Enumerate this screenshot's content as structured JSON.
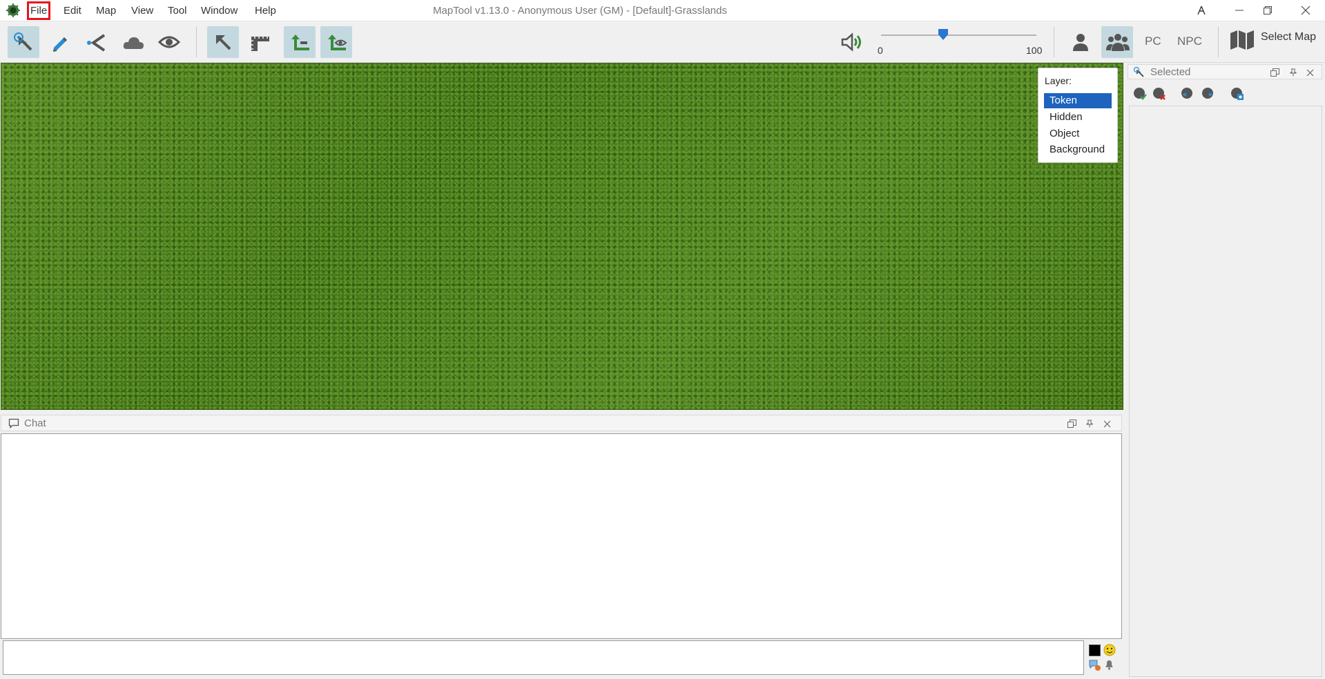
{
  "window": {
    "title": "MapTool v1.13.0 - Anonymous User (GM) - [Default]-Grasslands"
  },
  "menu": {
    "items": [
      {
        "label": "File",
        "highlighted": true
      },
      {
        "label": "Edit"
      },
      {
        "label": "Map"
      },
      {
        "label": "View"
      },
      {
        "label": "Tool"
      },
      {
        "label": "Window"
      },
      {
        "label": "Help"
      }
    ]
  },
  "toolbar": {
    "tools": [
      {
        "icon": "pointer-select-icon",
        "active": true
      },
      {
        "icon": "draw-pencil-icon",
        "active": false
      },
      {
        "icon": "template-cone-icon",
        "active": false
      },
      {
        "icon": "fog-cloud-icon",
        "active": false
      },
      {
        "icon": "vision-eye-icon",
        "active": false
      },
      {
        "icon": "arrow-select-icon",
        "active": true
      },
      {
        "icon": "measure-ruler-icon",
        "active": false
      },
      {
        "icon": "token-layer-minus-icon",
        "active": true
      },
      {
        "icon": "token-layer-vision-icon",
        "active": true
      }
    ],
    "volume": {
      "min_label": "0",
      "max_label": "100",
      "value": 40
    },
    "pc_label": "PC",
    "npc_label": "NPC",
    "select_map_label": "Select Map"
  },
  "map": {
    "name": "Grasslands",
    "layer_panel": {
      "title": "Layer:",
      "options": [
        "Token",
        "Hidden",
        "Object",
        "Background"
      ],
      "selected": "Token"
    }
  },
  "chat": {
    "title": "Chat",
    "input_value": "",
    "text_color": "#000000"
  },
  "selected_panel": {
    "title": "Selected"
  },
  "colors": {
    "accent": "#1e63be",
    "highlight_outline": "#e8121d",
    "active_tool_bg": "#c3d9df"
  }
}
